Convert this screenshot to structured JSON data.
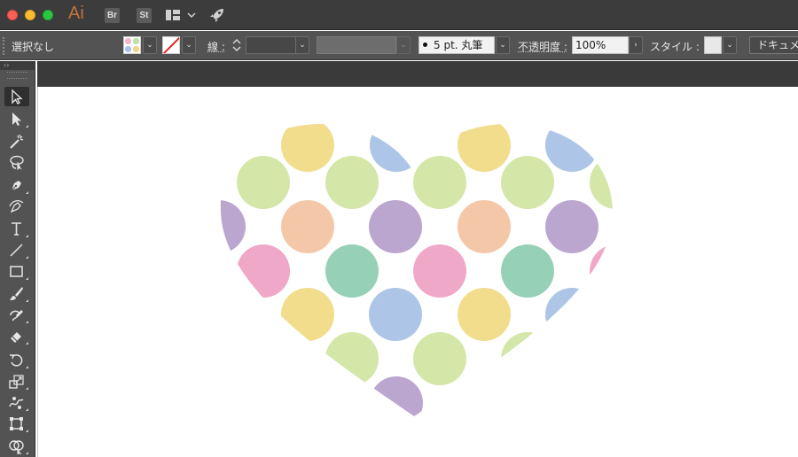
{
  "window": {
    "app_logo": "Ai",
    "bridge_badge": "Br",
    "stock_badge": "St"
  },
  "control_bar": {
    "selection_label": "選択なし",
    "stroke_label": "線 :",
    "brush_size": "5 pt. 丸筆",
    "opacity_label": "不透明度 :",
    "opacity_value": "100%",
    "style_label": "スタイル :",
    "document_button": "ドキュメ"
  },
  "icons": {
    "tools": [
      "selection-tool-icon",
      "direct-selection-tool-icon",
      "magic-wand-tool-icon",
      "lasso-tool-icon",
      "pen-tool-icon",
      "curvature-tool-icon",
      "type-tool-icon",
      "line-segment-tool-icon",
      "rectangle-tool-icon",
      "paintbrush-tool-icon",
      "shaper-tool-icon",
      "eraser-tool-icon",
      "rotate-tool-icon",
      "scale-tool-icon",
      "puppet-warp-tool-icon",
      "free-transform-tool-icon",
      "shape-builder-tool-icon"
    ]
  },
  "artwork": {
    "description_colors": {
      "yellow": "#f2dd8d",
      "blue": "#adc6e7",
      "green": "#d4e6a8",
      "peach": "#f5c7a9",
      "purple": "#bba6cf",
      "pink": "#efa8c7",
      "teal": "#96d0b6"
    }
  }
}
